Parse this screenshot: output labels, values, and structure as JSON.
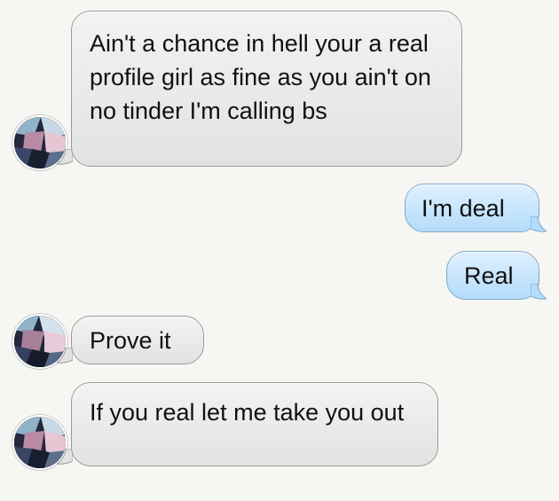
{
  "conversation": {
    "messages": [
      {
        "direction": "incoming",
        "text": "Ain't a chance in hell your a real profile girl as fine as you ain't on no tinder I'm calling bs",
        "has_avatar": true
      },
      {
        "direction": "outgoing",
        "text": "I'm deal",
        "has_avatar": false
      },
      {
        "direction": "outgoing",
        "text": "Real",
        "has_avatar": false
      },
      {
        "direction": "incoming",
        "text": "Prove it",
        "has_avatar": true
      },
      {
        "direction": "incoming",
        "text": "If you real let me take you out",
        "has_avatar": true
      }
    ]
  },
  "colors": {
    "background": "#f6f6f2",
    "incoming_bubble": "#e7e7e7",
    "outgoing_bubble": "#c6e6fd",
    "text": "#111111"
  },
  "icons": {
    "avatar": "contact-avatar-pixelated"
  }
}
